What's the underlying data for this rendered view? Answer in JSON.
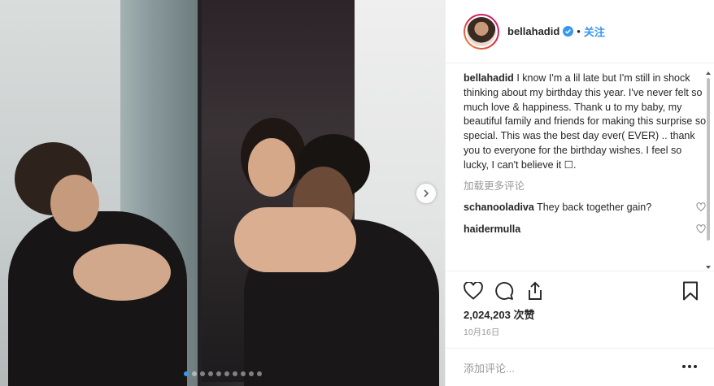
{
  "header": {
    "username": "bellahadid",
    "separator": "•",
    "follow_label": "关注"
  },
  "caption": {
    "username": "bellahadid",
    "text": "I know I'm a lil late but I'm still in shock thinking about my birthday this year. I've never felt so much love & happiness. Thank u to my baby, my beautiful family and friends for making this surprise so special. This was the best day ever( EVER) .. thank you to everyone for the birthday wishes. I feel so lucky, I can't believe it ☐."
  },
  "load_more_label": "加载更多评论",
  "comments": [
    {
      "username": "schanooladiva",
      "text": "They back together gain?"
    },
    {
      "username": "haidermulla",
      "text": ""
    }
  ],
  "likes_text": "2,024,203 次赞",
  "date_text": "10月16日",
  "add_comment_placeholder": "添加评论...",
  "carousel": {
    "total_slides": 10,
    "active_index": 0
  },
  "icons": {
    "like": "heart-outline-icon",
    "comment": "comment-bubble-icon",
    "share": "share-upload-icon",
    "save": "bookmark-icon",
    "verified": "verified-badge-icon",
    "more": "more-dots-icon",
    "next": "chevron-right-icon"
  },
  "colors": {
    "accent": "#3897f0",
    "muted": "#999999",
    "text": "#262626"
  }
}
